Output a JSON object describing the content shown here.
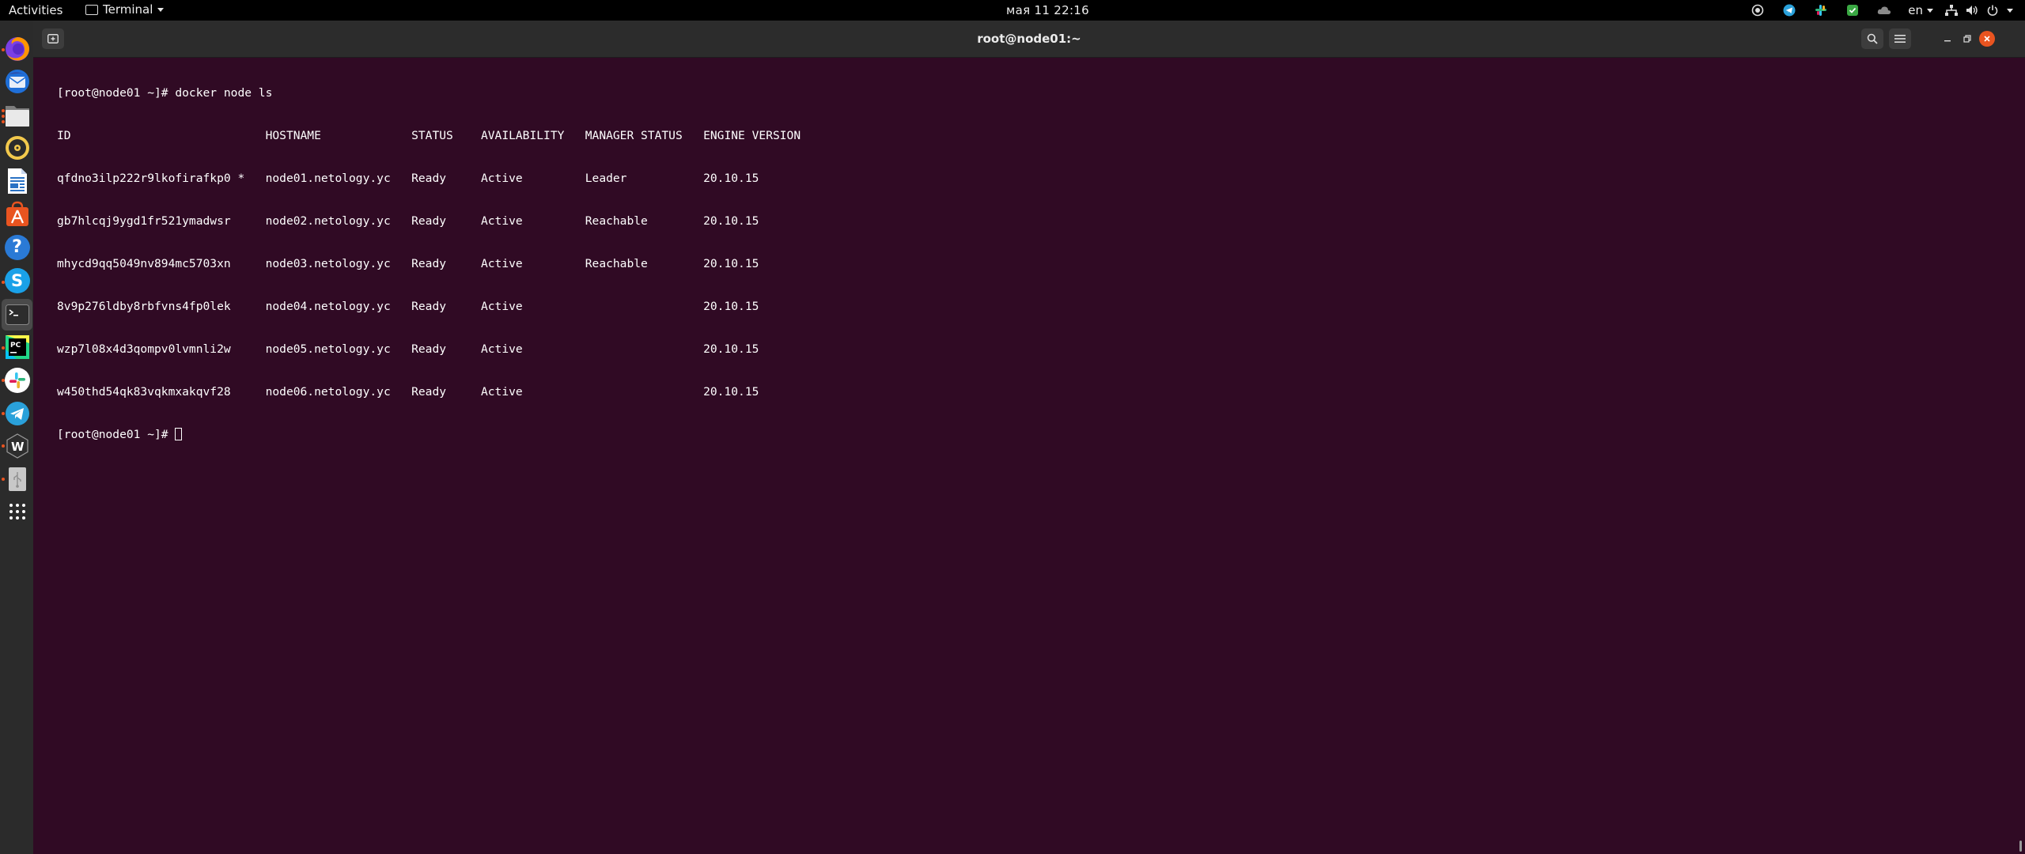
{
  "topbar": {
    "activities": "Activities",
    "app_menu_label": "Terminal",
    "clock": "мая 11  22:16",
    "language": "en",
    "tray_icons": [
      "indicator-icon",
      "telegram-tray-icon",
      "slack-tray-icon",
      "shield-tray-icon",
      "cloud-tray-icon"
    ],
    "system_icons": [
      "network-icon",
      "volume-icon",
      "power-icon"
    ]
  },
  "dock": {
    "apps": [
      {
        "name": "firefox",
        "running": true
      },
      {
        "name": "thunderbird",
        "running": false
      },
      {
        "name": "files",
        "running": true
      },
      {
        "name": "rhythmbox",
        "running": false
      },
      {
        "name": "libreoffice-writer",
        "running": false
      },
      {
        "name": "ubuntu-software",
        "running": false
      },
      {
        "name": "help",
        "running": false
      },
      {
        "name": "skype",
        "running": true
      },
      {
        "name": "terminal",
        "running": true
      },
      {
        "name": "pycharm",
        "running": true
      },
      {
        "name": "slack",
        "running": true
      },
      {
        "name": "telegram",
        "running": true
      },
      {
        "name": "wireguard",
        "running": true
      },
      {
        "name": "usb-drive",
        "running": true
      }
    ],
    "show_apps_label": "Show Applications"
  },
  "window": {
    "title": "root@node01:~"
  },
  "terminal": {
    "prompt_command": "[root@node01 ~]# docker node ls",
    "header": "ID                            HOSTNAME             STATUS    AVAILABILITY   MANAGER STATUS   ENGINE VERSION",
    "rows": [
      "qfdno3ilp222r9lkofirafkp0 *   node01.netology.yc   Ready     Active         Leader           20.10.15",
      "gb7hlcqj9ygd1fr521ymadwsr     node02.netology.yc   Ready     Active         Reachable        20.10.15",
      "mhycd9qq5049nv894mc5703xn     node03.netology.yc   Ready     Active         Reachable        20.10.15",
      "8v9p276ldby8rbfvns4fp0lek     node04.netology.yc   Ready     Active                          20.10.15",
      "wzp7l08x4d3qompv0lvmnli2w     node05.netology.yc   Ready     Active                          20.10.15",
      "w450thd54qk83vqkmxakqvf28     node06.netology.yc   Ready     Active                          20.10.15"
    ],
    "final_prompt": "[root@node01 ~]# "
  },
  "colors": {
    "terminal_bg": "#300a24",
    "terminal_fg": "#ffffff",
    "headerbar_bg": "#2c2c2c",
    "close_button": "#e95420",
    "running_indicator": "#e95420"
  }
}
